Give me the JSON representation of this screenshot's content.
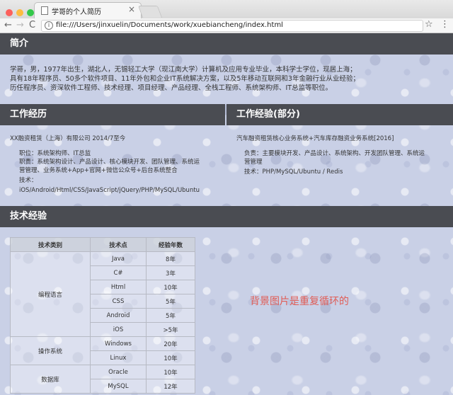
{
  "browser": {
    "tab_title": "学哥的个人简历",
    "tab_close": "×",
    "url": "file:///Users/jinxuelin/Documents/work/xuebiancheng/index.html",
    "back": "←",
    "forward": "→",
    "reload": "C",
    "star": "☆",
    "menu": "⋮"
  },
  "intro": {
    "heading": "简介",
    "lines": [
      "学哥，男，1977年出生，湖北人，无锡轻工大学（现江南大学）计算机及应用专业毕业，本科学士学位，现居上海；",
      "具有18年程序员、50多个软件项目、11年外包和企业IT系统解决方案，以及5年移动互联网和3年金融行业从业经验；",
      "历任程序员、资深软件工程师、技术经理、项目经理、产品经理、全栈工程师、系统架构师、IT总监等职位。"
    ]
  },
  "work": {
    "heading": "工作经历",
    "company": "XX融资租赁（上海）有限公司 2014/7至今",
    "lines": [
      "职位：系统架构师、IT总监",
      "职责：系统架构设计、产品设计、核心模块开发、团队管理、系统运",
      "营管理、业务系统+App+官网+微信公众号+后台系统整合",
      "技术：",
      "iOS/Android/Html/CSS/JavaScript/jQuery/PHP/MySQL/Ubuntu"
    ]
  },
  "experience": {
    "heading": "工作经验(部分)",
    "project": "汽车融资租赁核心业务系统+汽车库存融资业务系统[2016]",
    "lines": [
      "负责：主要模块开发、产品设计、系统架构、开发团队管理、系统运",
      "营管理",
      "技术：PHP/MySQL/Ubuntu / Redis"
    ]
  },
  "skills": {
    "heading": "技术经验",
    "columns": [
      "技术类别",
      "技术点",
      "经验年数"
    ],
    "groups": [
      {
        "category": "编程语言",
        "rows": [
          [
            "Java",
            "8年"
          ],
          [
            "C#",
            "3年"
          ],
          [
            "Html",
            "10年"
          ],
          [
            "CSS",
            "5年"
          ],
          [
            "Android",
            "5年"
          ],
          [
            "iOS",
            ">5年"
          ]
        ]
      },
      {
        "category": "操作系统",
        "rows": [
          [
            "Windows",
            "20年"
          ],
          [
            "Linux",
            "10年"
          ]
        ]
      },
      {
        "category": "数据库",
        "rows": [
          [
            "Oracle",
            "10年"
          ],
          [
            "MySQL",
            "12年"
          ]
        ]
      }
    ]
  },
  "note": "背景图片是重复循环的",
  "colors": {
    "header_bg": "#4a4c52",
    "note_red": "#e05c55"
  }
}
